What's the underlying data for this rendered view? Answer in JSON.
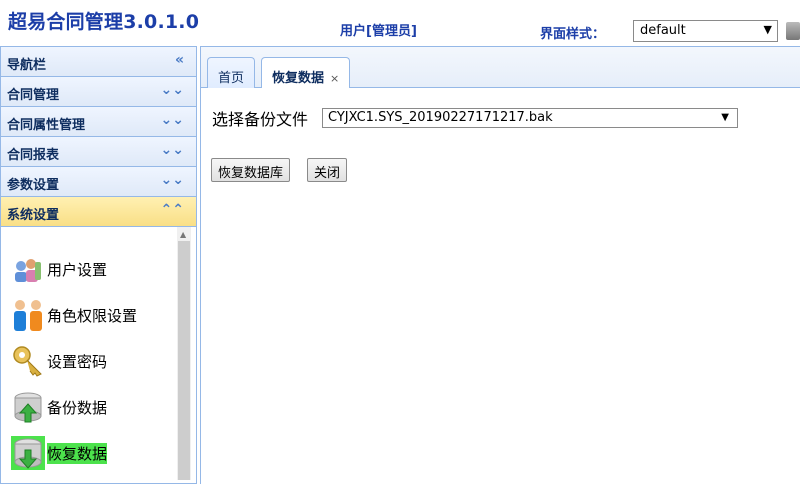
{
  "header": {
    "title": "超易合同管理3.0.1.0",
    "user": "用户[管理员]",
    "theme_label": "界面样式：",
    "theme_value": "default"
  },
  "sidebar": {
    "title": "导航栏",
    "sections": [
      {
        "label": "合同管理"
      },
      {
        "label": "合同属性管理"
      },
      {
        "label": "合同报表"
      },
      {
        "label": "参数设置"
      },
      {
        "label": "系统设置"
      }
    ],
    "items": [
      {
        "label": "用户设置",
        "icon": "users-settings-icon"
      },
      {
        "label": "角色权限设置",
        "icon": "role-people-icon"
      },
      {
        "label": "设置密码",
        "icon": "key-icon"
      },
      {
        "label": "备份数据",
        "icon": "database-backup-icon"
      },
      {
        "label": "恢复数据",
        "icon": "database-restore-icon"
      }
    ],
    "selected_item": "恢复数据"
  },
  "tabs": [
    {
      "label": "首页"
    },
    {
      "label": "恢复数据",
      "close": "×"
    }
  ],
  "content": {
    "file_label": "选择备份文件",
    "file_value": "CYJXC1.SYS_20190227171217.bak",
    "restore_button": "恢复数据库",
    "close_button": "关闭"
  },
  "colors": {
    "title": "#1c3ea8",
    "border": "#95b8e7",
    "active_section": "#f9df86",
    "selected_item": "#4ce24c"
  }
}
